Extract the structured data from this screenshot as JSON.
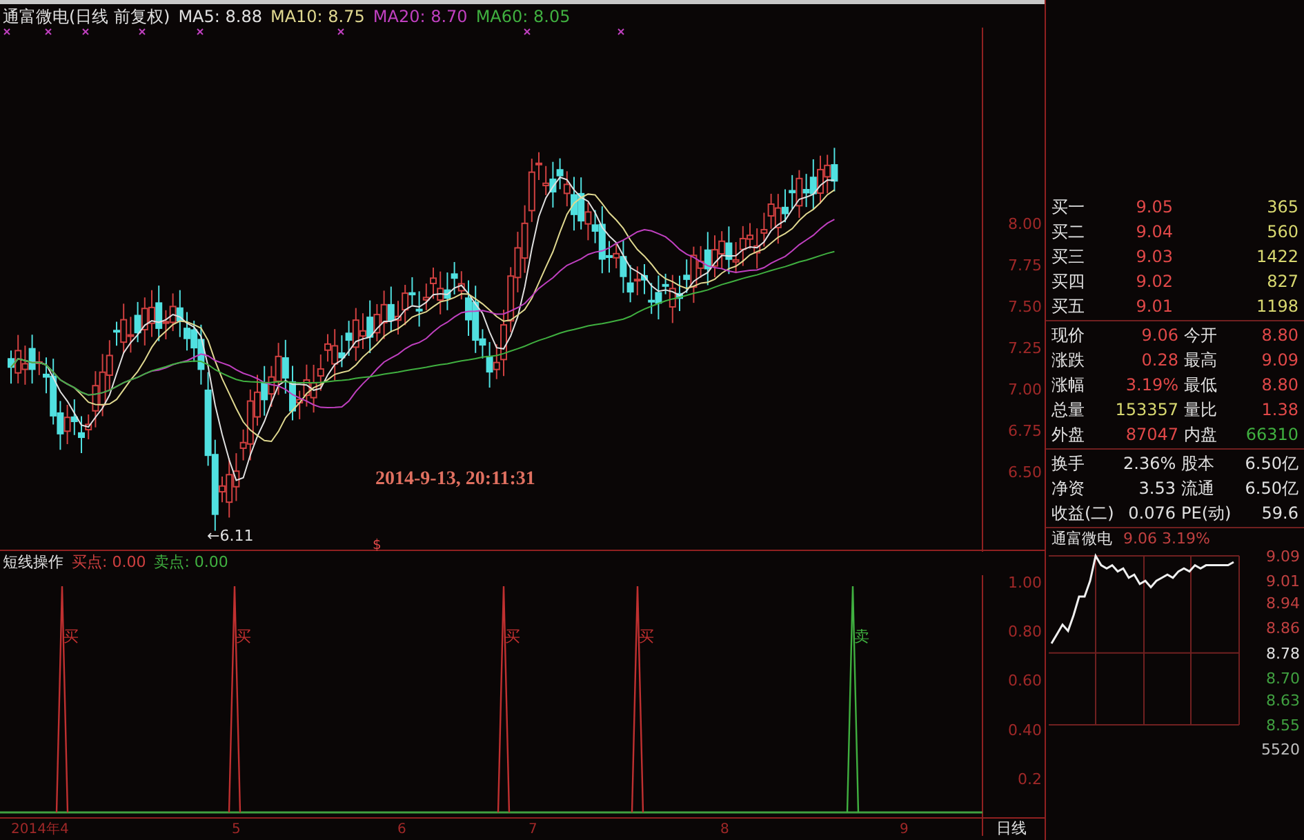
{
  "chart_header": {
    "title": "通富微电(日线 前复权)",
    "ma": [
      {
        "label": "MA5: 8.88",
        "color": "#e0e0e0"
      },
      {
        "label": "MA10: 8.75",
        "color": "#e0d890"
      },
      {
        "label": "MA20: 8.70",
        "color": "#c040c0"
      },
      {
        "label": "MA60: 8.05",
        "color": "#40b040"
      }
    ]
  },
  "price_axis": [
    "8.00",
    "7.75",
    "7.50",
    "7.25",
    "7.00",
    "6.75",
    "6.50"
  ],
  "low_marker": "←6.11",
  "timestamp": "2014-9-13, 20:11:31",
  "dollar_mark": "$",
  "indicator": {
    "title": "短线操作",
    "buy": "买点: 0.00",
    "sell": "卖点: 0.00",
    "axis": [
      "1.00",
      "0.80",
      "0.60",
      "0.40",
      "0.2"
    ],
    "signals": [
      {
        "label": "买",
        "kind": "buy"
      },
      {
        "label": "买",
        "kind": "buy"
      },
      {
        "label": "买",
        "kind": "buy"
      },
      {
        "label": "买",
        "kind": "buy"
      },
      {
        "label": "卖",
        "kind": "sell"
      }
    ]
  },
  "date_axis": [
    "2014年4",
    "5",
    "6",
    "7",
    "8",
    "9"
  ],
  "period_tab": "日线",
  "order_book": [
    {
      "label": "买一",
      "price": "9.05",
      "volume": "365"
    },
    {
      "label": "买二",
      "price": "9.04",
      "volume": "560"
    },
    {
      "label": "买三",
      "price": "9.03",
      "volume": "1422"
    },
    {
      "label": "买四",
      "price": "9.02",
      "volume": "827"
    },
    {
      "label": "买五",
      "price": "9.01",
      "volume": "1198"
    }
  ],
  "quote": [
    {
      "cells": [
        {
          "label": "现价",
          "value": "9.06",
          "color": "#e04848"
        },
        {
          "label": "今开",
          "value": "8.80",
          "color": "#e04848"
        }
      ]
    },
    {
      "cells": [
        {
          "label": "涨跌",
          "value": "0.28",
          "color": "#e04848"
        },
        {
          "label": "最高",
          "value": "9.09",
          "color": "#e04848"
        }
      ]
    },
    {
      "cells": [
        {
          "label": "涨幅",
          "value": "3.19%",
          "color": "#e04848"
        },
        {
          "label": "最低",
          "value": "8.80",
          "color": "#e04848"
        }
      ]
    },
    {
      "cells": [
        {
          "label": "总量",
          "value": "153357",
          "color": "#d8d870"
        },
        {
          "label": "量比",
          "value": "1.38",
          "color": "#e04848"
        }
      ]
    },
    {
      "cells": [
        {
          "label": "外盘",
          "value": "87047",
          "color": "#e04848"
        },
        {
          "label": "内盘",
          "value": "66310",
          "color": "#40b040"
        }
      ]
    }
  ],
  "fundamentals": [
    {
      "label": "换手",
      "value": "2.36%",
      "label2": "股本",
      "value2": "6.50亿"
    },
    {
      "label": "净资",
      "value": "3.53",
      "label2": "流通",
      "value2": "6.50亿"
    },
    {
      "label": "收益(二)",
      "value": "0.076",
      "label2": "PE(动)",
      "value2": "59.6"
    }
  ],
  "intraday": {
    "name": "通富微电",
    "reading": "9.06 3.19%",
    "volume_label": {
      "label": "5520",
      "color": "#c0c0c0"
    },
    "tick_styles": [
      {
        "color": "#c04040"
      },
      {
        "color": "#c04040"
      },
      {
        "color": "#c04040"
      },
      {
        "color": "#c04040"
      },
      {
        "color": "#e0e0e0"
      },
      {
        "color": "#40a040"
      },
      {
        "color": "#40a040"
      },
      {
        "color": "#40a040"
      }
    ],
    "chart_data": {
      "type": "line",
      "ylim": [
        8.55,
        9.09
      ],
      "grid": true,
      "yticks": [
        {
          "value": 9.09,
          "label": "9.09"
        },
        {
          "value": 9.01,
          "label": "9.01"
        },
        {
          "value": 8.94,
          "label": "8.94"
        },
        {
          "value": 8.86,
          "label": "8.86"
        },
        {
          "value": 8.78,
          "label": "8.78"
        },
        {
          "value": 8.7,
          "label": "8.70"
        },
        {
          "value": 8.63,
          "label": "8.63"
        },
        {
          "value": 8.55,
          "label": "8.55"
        }
      ],
      "series": [
        {
          "color": "#f0f0f0",
          "values": [
            8.81,
            8.84,
            8.87,
            8.85,
            8.9,
            8.96,
            8.96,
            9.01,
            9.09,
            9.06,
            9.05,
            9.06,
            9.04,
            9.05,
            9.02,
            9.03,
            9.0,
            9.01,
            8.99,
            9.01,
            9.02,
            9.03,
            9.02,
            9.04,
            9.05,
            9.04,
            9.06,
            9.05,
            9.06,
            9.06,
            9.06,
            9.06,
            9.06,
            9.07
          ]
        }
      ]
    }
  }
}
